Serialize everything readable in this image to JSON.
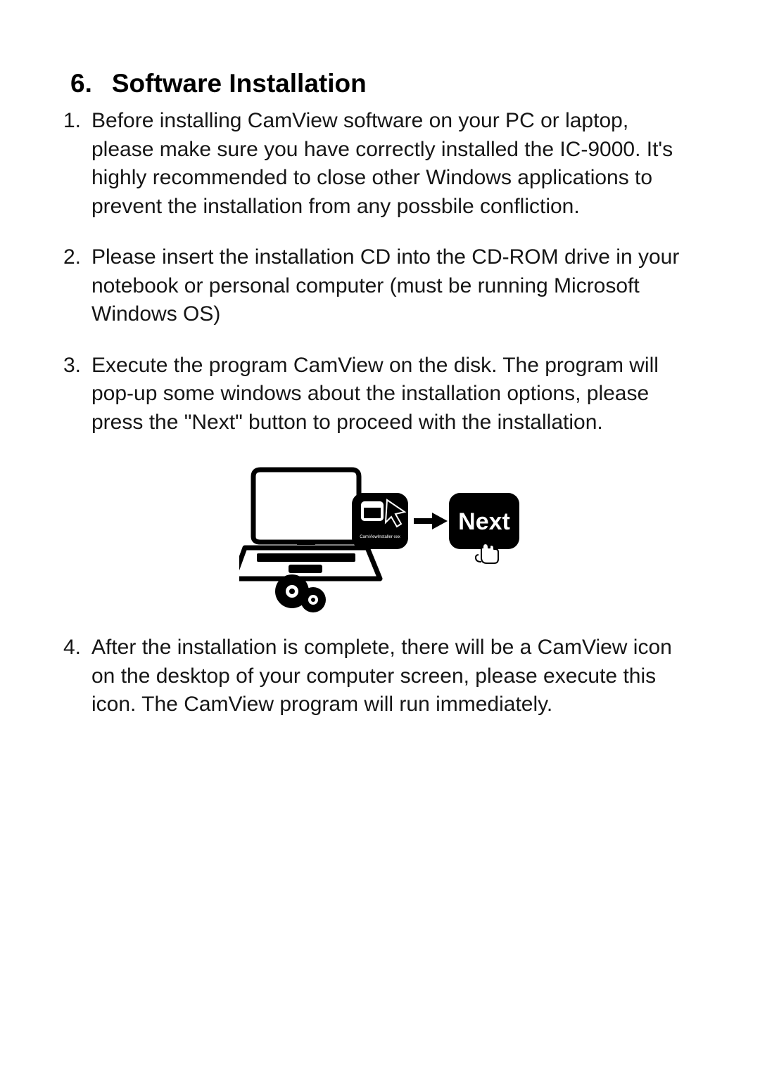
{
  "heading": {
    "number": "6.",
    "title": "Software Installation"
  },
  "items": [
    {
      "number": "1.",
      "text": "Before installing CamView software on your PC or laptop, please make sure you have correctly installed the IC-9000. It's highly recommended to close other Windows applications to prevent the installation from any possbile confliction."
    },
    {
      "number": "2.",
      "text": "Please insert the installation CD into the CD-ROM drive in your notebook or personal computer (must be running Microsoft Windows OS)"
    },
    {
      "number": "3.",
      "text": "Execute the program CamView on the disk. The program will pop-up some windows about the installation options, please press the \"Next\" button to proceed with the installation."
    },
    {
      "number": "4.",
      "text": "After the installation is complete, there will be a CamView icon on the desktop of your computer screen, please execute this icon. The CamView program will run immediately."
    }
  ],
  "illustration": {
    "installer_label": "CamViewInstaller-xxx",
    "next_label": "Next"
  }
}
